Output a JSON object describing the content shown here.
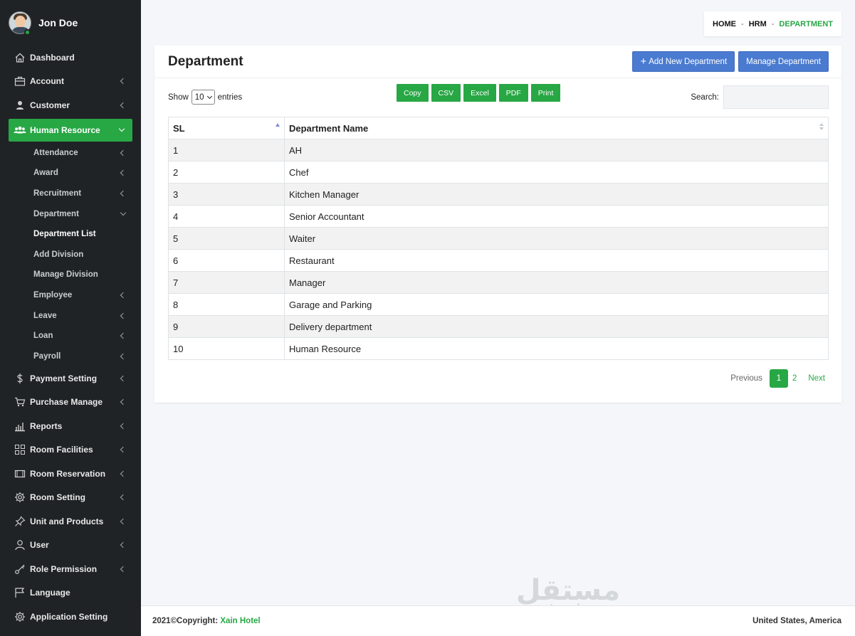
{
  "user": {
    "name": "Jon Doe"
  },
  "sidebar": {
    "items": [
      {
        "label": "Dashboard",
        "icon": "home-icon"
      },
      {
        "label": "Account",
        "icon": "briefcase-icon"
      },
      {
        "label": "Customer",
        "icon": "person-icon"
      },
      {
        "label": "Human Resource",
        "icon": "users-icon"
      },
      {
        "label": "Payment Setting",
        "icon": "dollar-icon"
      },
      {
        "label": "Purchase Manage",
        "icon": "cart-icon"
      },
      {
        "label": "Reports",
        "icon": "bar-chart-icon"
      },
      {
        "label": "Room Facilities",
        "icon": "grid-icon"
      },
      {
        "label": "Room Reservation",
        "icon": "window-icon"
      },
      {
        "label": "Room Setting",
        "icon": "gear-icon"
      },
      {
        "label": "Unit and Products",
        "icon": "pin-icon"
      },
      {
        "label": "User",
        "icon": "user-outline-icon"
      },
      {
        "label": "Role Permission",
        "icon": "key-icon"
      },
      {
        "label": "Language",
        "icon": "flag-icon"
      },
      {
        "label": "Application Setting",
        "icon": "gear-icon"
      }
    ],
    "hr_sub": [
      {
        "label": "Attendance"
      },
      {
        "label": "Award"
      },
      {
        "label": "Recruitment"
      },
      {
        "label": "Department"
      },
      {
        "label": "Department List"
      },
      {
        "label": "Add Division"
      },
      {
        "label": "Manage Division"
      },
      {
        "label": "Employee"
      },
      {
        "label": "Leave"
      },
      {
        "label": "Loan"
      },
      {
        "label": "Payroll"
      }
    ]
  },
  "breadcrumb": {
    "home": "HOME",
    "hrm": "HRM",
    "current": "DEPARTMENT",
    "sep": "-"
  },
  "card": {
    "title": "Department",
    "add_button": "Add New Department",
    "manage_button": "Manage Department"
  },
  "toolbar": {
    "show_label": "Show",
    "entries_value": "10",
    "entries_label": "entries",
    "export": [
      "Copy",
      "CSV",
      "Excel",
      "PDF",
      "Print"
    ],
    "search_label": "Search:",
    "search_value": ""
  },
  "table": {
    "headers": [
      "SL",
      "Department Name"
    ],
    "rows": [
      [
        "1",
        "AH"
      ],
      [
        "2",
        "Chef"
      ],
      [
        "3",
        "Kitchen Manager"
      ],
      [
        "4",
        "Senior Accountant"
      ],
      [
        "5",
        "Waiter"
      ],
      [
        "6",
        "Restaurant"
      ],
      [
        "7",
        "Manager"
      ],
      [
        "8",
        "Garage and Parking"
      ],
      [
        "9",
        "Delivery department"
      ],
      [
        "10",
        "Human Resource"
      ]
    ]
  },
  "pagination": {
    "previous": "Previous",
    "pages": [
      "1",
      "2"
    ],
    "next": "Next"
  },
  "footer": {
    "copyright": "2021©Copyright:",
    "brand": "Xain Hotel",
    "location": "United States, America"
  },
  "watermark": {
    "arabic": "مستقل",
    "latin": "mostaql.com"
  },
  "colors": {
    "accent": "#28a745",
    "primary_button": "#4a7bd1",
    "sidebar_bg": "#1f2326"
  }
}
